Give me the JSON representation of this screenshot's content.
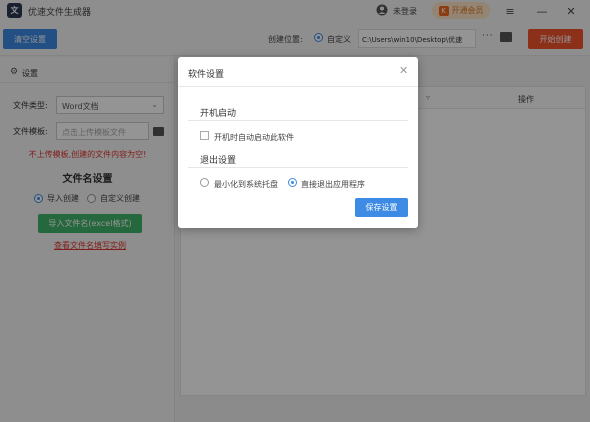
{
  "app": {
    "title": "优速文件生成器",
    "logo_glyph": "文"
  },
  "header": {
    "login_label": "未登录",
    "vip_label": "开通会员",
    "vip_badge": "K"
  },
  "window_controls": {
    "menu": "≡",
    "minimize": "—",
    "close": "✕"
  },
  "toolbar": {
    "clear_button": "清空设置",
    "location_label": "创建位置:",
    "custom_label": "自定义",
    "path_value": "C:\\Users\\win10\\Desktop\\优速",
    "more_label": "···",
    "start_button": "开始创建"
  },
  "sidebar": {
    "header": "设置",
    "file_type_label": "文件类型:",
    "file_type_value": "Word文档",
    "template_label": "文件模板:",
    "template_placeholder": "点击上传模板文件",
    "warning": "不上传模板,创建的文件内容为空!",
    "name_section_title": "文件名设置",
    "option_import": "导入创建",
    "option_custom": "自定义创建",
    "import_button": "导入文件名(excel格式)",
    "example_link": "查看文件名填写实例"
  },
  "main": {
    "op_column": "操作"
  },
  "dialog": {
    "title": "软件设置",
    "startup_title": "开机启动",
    "startup_option": "开机时自动启动此软件",
    "exit_title": "退出设置",
    "exit_tray": "最小化到系统托盘",
    "exit_quit": "直接退出应用程序",
    "save_button": "保存设置"
  },
  "colors": {
    "accent_blue": "#3d8be4",
    "accent_orange": "#f2542d",
    "accent_green": "#43b36b",
    "warning_red": "#e0352b"
  }
}
